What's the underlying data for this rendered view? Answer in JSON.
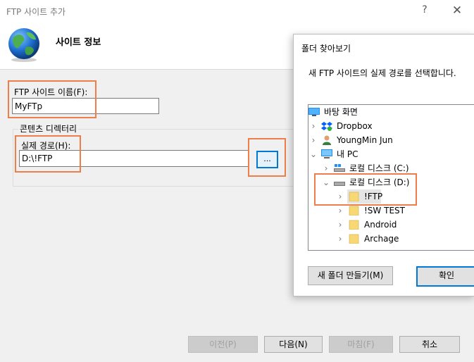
{
  "main_dialog": {
    "title": "FTP 사이트 추가",
    "help": "?",
    "close": "✕",
    "section_title": "사이트 정보",
    "site_name_label": "FTP 사이트 이름(F):",
    "site_name_value": "MyFTp",
    "content_dir_label": "콘텐츠 디렉터리",
    "physical_path_label": "실제 경로(H):",
    "physical_path_value": "D:\\!FTP",
    "browse_label": "...",
    "buttons": {
      "prev": "이전(P)",
      "next": "다음(N)",
      "finish": "마침(F)",
      "cancel": "취소"
    }
  },
  "folder_dialog": {
    "title": "폴더 찾아보기",
    "description": "새 FTP 사이트의 실제 경로를 선택합니다.",
    "tree": [
      {
        "label": "바탕 화면",
        "icon": "desktop-icon"
      },
      {
        "label": "Dropbox",
        "icon": "dropbox-icon"
      },
      {
        "label": "YoungMin Jun",
        "icon": "user-icon"
      },
      {
        "label": "내 PC",
        "icon": "pc-icon"
      },
      {
        "label": "로컬 디스크 (C:)",
        "icon": "drive-icon"
      },
      {
        "label": "로컬 디스크 (D:)",
        "icon": "drive-icon"
      },
      {
        "label": "!FTP",
        "icon": "folder-icon"
      },
      {
        "label": "!SW TEST",
        "icon": "folder-icon"
      },
      {
        "label": "Android",
        "icon": "folder-icon"
      },
      {
        "label": "Archage",
        "icon": "folder-icon"
      }
    ],
    "new_folder_label": "새 폴더 만들기(M)",
    "ok_label": "확인"
  },
  "colors": {
    "highlight": "#ee7f4b",
    "focus_blue": "#0078d7",
    "folder_yellow": "#f8d775"
  }
}
